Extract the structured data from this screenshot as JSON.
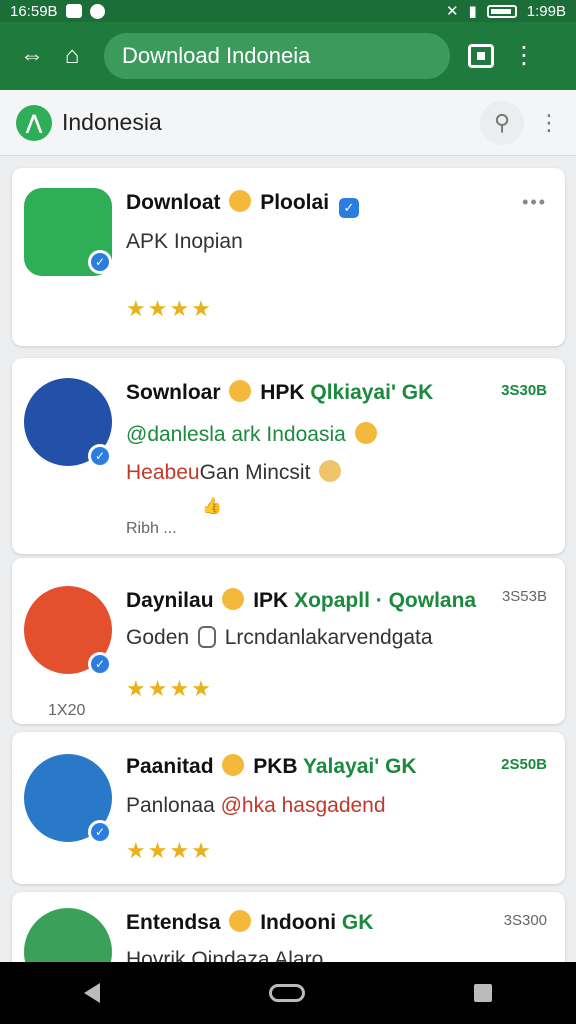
{
  "status": {
    "time": "16:59B",
    "right_time": "1:99B"
  },
  "browser": {
    "url": "Download Indoneia"
  },
  "header": {
    "title": "Indonesia"
  },
  "cards": [
    {
      "name": "Downloat",
      "name2": "Ploolai",
      "sub": "APK Inopian",
      "stars": "★★★★",
      "colors": {
        "icon": "#2fae58"
      }
    },
    {
      "name": "Sownloar",
      "name2": "HPK",
      "name_tag": "Qlkiayai' GK",
      "count": "3S30B",
      "sub_green": "@danlesla ark Indoasia",
      "sub_red": "Heabeu",
      "sub_rest": "Gan Mincsit",
      "meta": "Ribh ..."
    },
    {
      "name": "Daynilau",
      "name2": "IPK",
      "name_tag": "Xopapll · Qowlana",
      "count": "3S53B",
      "sub": "Goden",
      "sub_rest": "Lrcndanlakarvendgata",
      "stars": "★★★★",
      "meta": "1X20"
    },
    {
      "name": "Paanitad",
      "name2": "PKB",
      "name_tag": "Yalayai' GK",
      "count": "2S50B",
      "sub": "Panlonaa",
      "sub_red": "@hka hasgadend",
      "stars": "★★★★"
    },
    {
      "name": "Entendsa",
      "name2": "Indooni",
      "name_tag": "GK",
      "count": "3S300",
      "sub": "Hovrik Qindaza Alaro"
    }
  ]
}
